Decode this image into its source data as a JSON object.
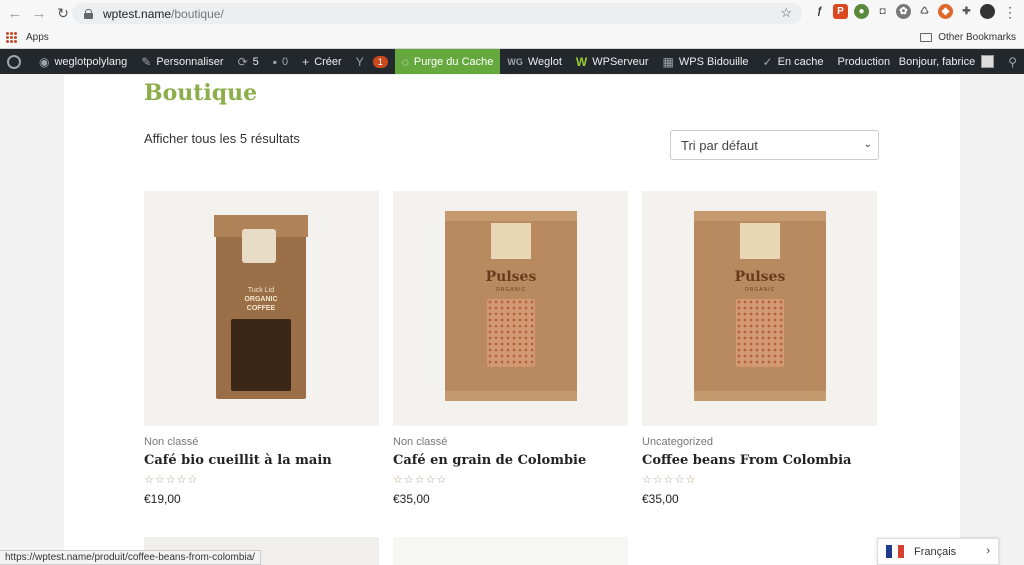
{
  "browser": {
    "url_host": "wptest.name",
    "url_path": "/boutique/",
    "apps_label": "Apps",
    "other_bookmarks": "Other Bookmarks"
  },
  "adminbar": {
    "site": "weglotpolylang",
    "customize": "Personnaliser",
    "updates": "5",
    "comments": "0",
    "new": "Créer",
    "yoast_badge": "1",
    "purge": "Purge du Cache",
    "weglot": "Weglot",
    "wpserveur": "WPServeur",
    "wps": "WPS Bidouille",
    "cache": "En cache",
    "production": "Production",
    "greeting": "Bonjour, fabrice"
  },
  "shop": {
    "title": "Boutique",
    "result_count": "Afficher tous les 5 résultats",
    "sort_selected": "Tri par défaut"
  },
  "products": [
    {
      "category": "Non classé",
      "name": "Café bio cueillit à la main",
      "price": "€19,00",
      "stars": "☆☆☆☆☆",
      "bag": {
        "line1": "Tuck Lid",
        "line2": "ORGANIC",
        "line3": "COFFEE"
      }
    },
    {
      "category": "Non classé",
      "name": "Café en grain de Colombie",
      "price": "€35,00",
      "stars": "☆☆☆☆☆",
      "bag": {
        "word": "Pulses",
        "sub": "ORGANIC"
      }
    },
    {
      "category": "Uncategorized",
      "name": "Coffee beans From Colombia",
      "price": "€35,00",
      "stars": "☆☆☆☆☆",
      "bag": {
        "word": "Pulses",
        "sub": "ORGANIC"
      }
    }
  ],
  "status_url": "https://wptest.name/produit/coffee-beans-from-colombia/",
  "language": "Français",
  "colors": {
    "accent": "#8bae4a",
    "adminbar": "#23282d",
    "purge": "#65a83d"
  }
}
